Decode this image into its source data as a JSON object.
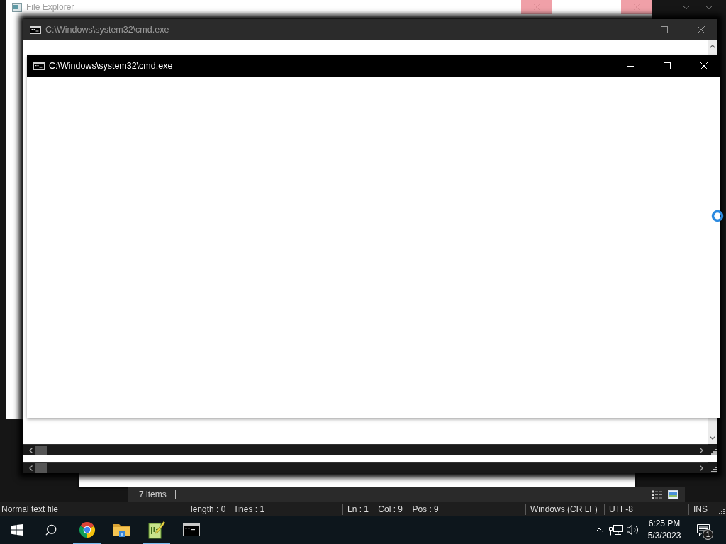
{
  "editor_window": {
    "status_bar": {
      "fields": [
        "Normal text file",
        "length : 0    lines : 1",
        "Ln : 1    Col : 9    Pos : 9",
        "Windows (CR LF)",
        "UTF-8",
        "INS"
      ]
    }
  },
  "file_explorer": {
    "title": "File Explorer",
    "status": "7 items"
  },
  "console_windows": [
    {
      "title": "C:\\Windows\\system32\\cmd.exe",
      "active": false
    },
    {
      "title": "C:\\Windows\\system32\\cmd.exe",
      "active": true
    }
  ],
  "taskbar": {
    "apps": [
      {
        "kind": "browser",
        "running": true
      },
      {
        "kind": "folder",
        "running": false
      },
      {
        "kind": "notepad",
        "running": true
      },
      {
        "kind": "console",
        "running": false
      }
    ],
    "clock": {
      "time": "6:25 PM",
      "date": "5/3/2023"
    },
    "notification_count": "1"
  }
}
